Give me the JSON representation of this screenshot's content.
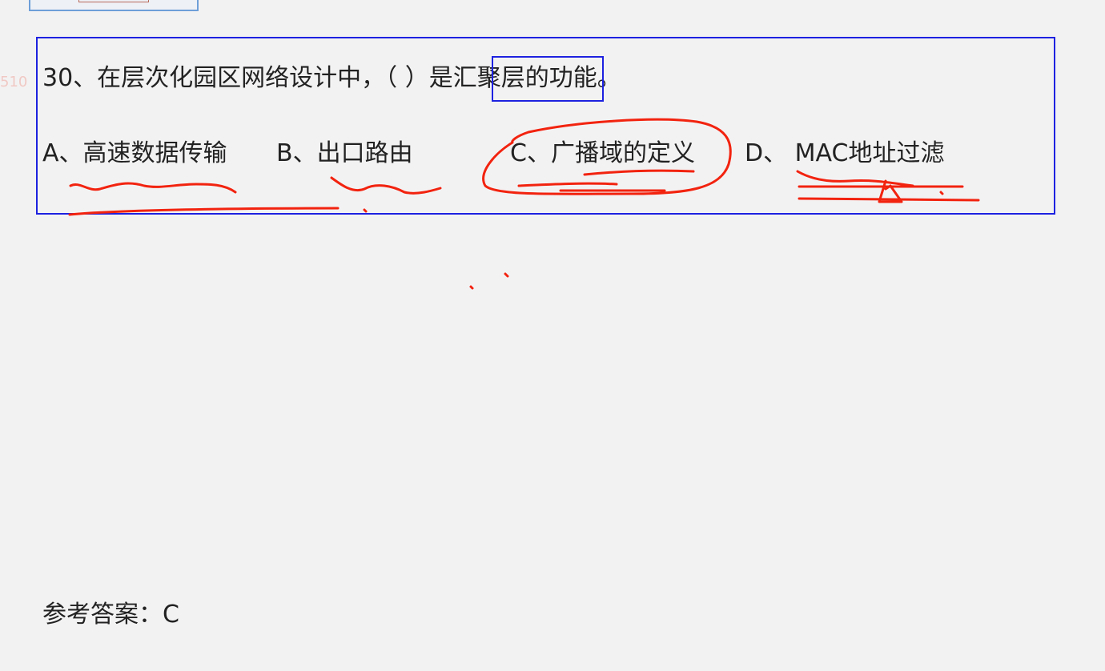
{
  "line_number": "510",
  "question": {
    "text": "30、在层次化园区网络设计中，（ ）是汇聚层的功能。"
  },
  "options": {
    "a": "A、高速数据传输",
    "b": "B、出口路由",
    "c": "C、广播域的定义",
    "d": "D、 MAC地址过滤"
  },
  "answer": "参考答案：C",
  "colors": {
    "box_border": "#1d22e0",
    "annotation": "#f2230f",
    "background": "#f3f2f3"
  }
}
